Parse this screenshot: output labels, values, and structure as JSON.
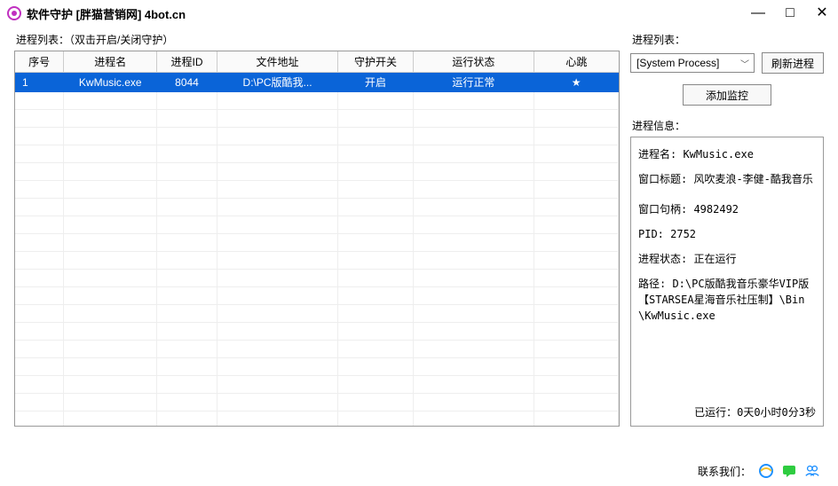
{
  "window": {
    "title": "软件守护  [胖猫营销网] 4bot.cn"
  },
  "left": {
    "label": "进程列表：（双击开启/关闭守护）",
    "columns": {
      "seq": "序号",
      "name": "进程名",
      "pid": "进程ID",
      "path": "文件地址",
      "switch": "守护开关",
      "status": "运行状态",
      "hb": "心跳"
    },
    "row": {
      "seq": "1",
      "name": "KwMusic.exe",
      "pid": "8044",
      "path": "D:\\PC版酷我...",
      "switch": "开启",
      "status": "运行正常",
      "hb": "★"
    }
  },
  "right": {
    "list_label": "进程列表：",
    "combo_value": "[System Process]",
    "refresh_label": "刷新进程",
    "add_label": "添加监控",
    "info_label": "进程信息：",
    "info": {
      "name": "进程名: KwMusic.exe",
      "title": "窗口标题: 风吹麦浪-李健-酷我音乐",
      "hwnd": "窗口句柄: 4982492",
      "pid": "PID: 2752",
      "status": "进程状态: 正在运行",
      "path": "路径: D:\\PC版酷我音乐豪华VIP版【STARSEA星海音乐社压制】\\Bin\\KwMusic.exe"
    },
    "runtime": "已运行：0天0小时0分3秒"
  },
  "footer": {
    "label": "联系我们："
  }
}
